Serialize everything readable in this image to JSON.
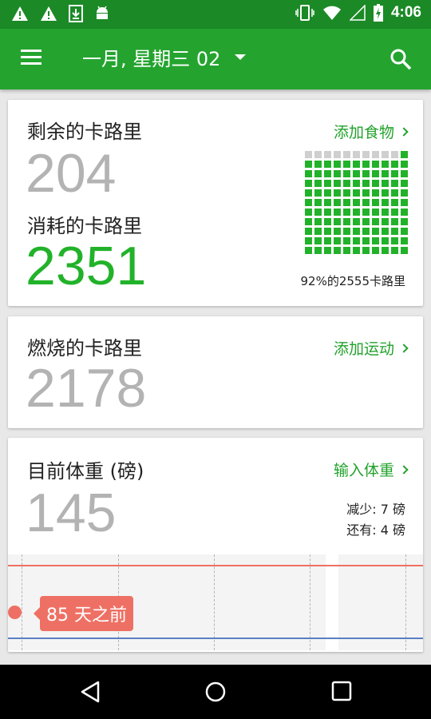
{
  "status_bar": {
    "time": "4:06",
    "icons": [
      "warning-icon",
      "warning-icon",
      "download-icon",
      "android-icon",
      "vibrate-icon",
      "wifi-icon",
      "signal-icon",
      "battery-charging-icon"
    ]
  },
  "app_bar": {
    "date_title": "一月, 星期三 02",
    "icons": [
      "menu-icon",
      "dropdown-caret-icon",
      "search-icon"
    ]
  },
  "calories_card": {
    "remaining_label": "剩余的卡路里",
    "remaining_value": "204",
    "consumed_label": "消耗的卡路里",
    "consumed_value": "2351",
    "add_food_link": "添加食物",
    "progress_label": "92%的2555卡路里",
    "progress_fraction": 0.92,
    "accent_color": "#22b22a"
  },
  "burned_card": {
    "label": "燃烧的卡路里",
    "value": "2178",
    "add_exercise_link": "添加运动"
  },
  "weight_card": {
    "label": "目前体重 (磅)",
    "value": "145",
    "enter_weight_link": "输入体重",
    "lost_text": "减少: 7 磅",
    "remaining_text": "还有: 4 磅",
    "chart_tooltip": "85 天之前",
    "marker_color": "#ee7064",
    "goal_line_color": "#5a7fc2"
  },
  "nav_bar": {
    "icons": [
      "back-icon",
      "home-icon",
      "recents-icon"
    ]
  }
}
